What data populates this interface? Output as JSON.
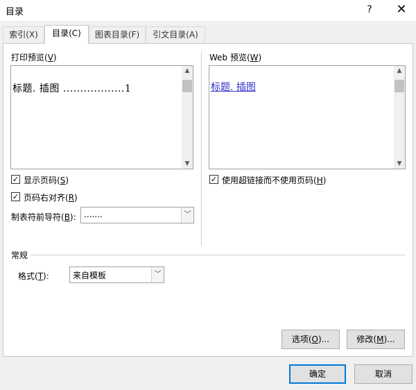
{
  "window": {
    "title": "目录",
    "help_label": "?",
    "close_label": "✕"
  },
  "tabs": [
    {
      "label": "索引(X)"
    },
    {
      "label": "目录(C)"
    },
    {
      "label": "图表目录(F)"
    },
    {
      "label": "引文目录(A)"
    }
  ],
  "print_preview": {
    "label_text": "打印预览(",
    "label_key": "V",
    "label_end": ")",
    "entry": "标题. 插图 ..................1"
  },
  "web_preview": {
    "label_text": "Web 预览(",
    "label_key": "W",
    "label_end": ")",
    "entry": "标题. 插图"
  },
  "options": {
    "show_page_numbers": {
      "label_text": "显示页码(",
      "label_key": "S",
      "label_end": ")",
      "checked": "✓"
    },
    "right_align": {
      "label_text": "页码右对齐(",
      "label_key": "R",
      "label_end": ")",
      "checked": "✓"
    },
    "tab_leader": {
      "label_text": "制表符前导符(",
      "label_key": "B",
      "label_end": "):",
      "value": "......."
    },
    "use_hyperlinks": {
      "label_text": "使用超链接而不使用页码(",
      "label_key": "H",
      "label_end": ")",
      "checked": "✓"
    }
  },
  "general": {
    "heading": "常规",
    "format": {
      "label_text": "格式(",
      "label_key": "T",
      "label_end": "):",
      "value": "来自模板"
    }
  },
  "buttons": {
    "options": {
      "label_text": "选项(",
      "label_key": "O",
      "label_end": ")..."
    },
    "modify": {
      "label_text": "修改(",
      "label_key": "M",
      "label_end": ")..."
    },
    "ok": "确定",
    "cancel": "取消"
  },
  "icons": {
    "dropdown": "chevron-down-icon",
    "check": "check-icon"
  },
  "colors": {
    "accent": "#0078d7",
    "link": "#3030c8"
  }
}
